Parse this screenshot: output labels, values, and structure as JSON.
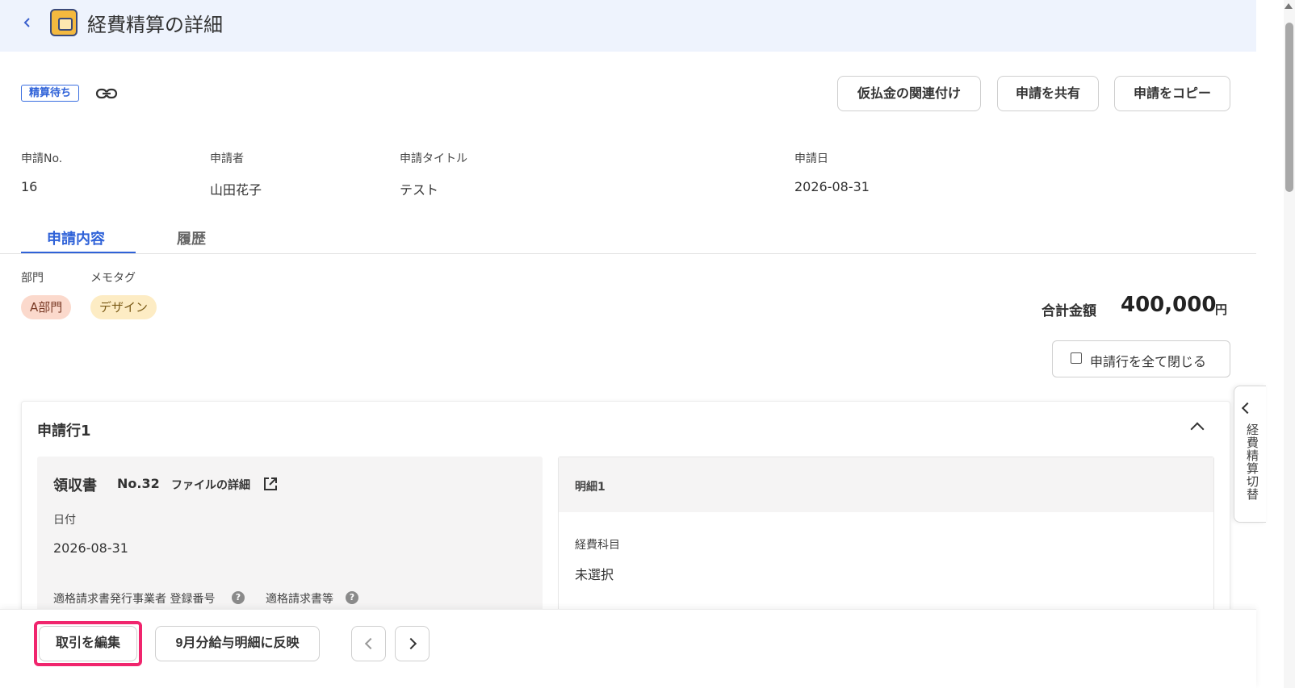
{
  "header": {
    "back_icon": "chevron-left-icon",
    "app_icon": "wallet-icon",
    "title": "経費精算の詳細"
  },
  "status": {
    "badge": "精算待ち",
    "link_icon": "link-icon"
  },
  "actions": {
    "link_advance": "仮払金の関連付け",
    "share": "申請を共有",
    "copy": "申請をコピー"
  },
  "info": {
    "no_label": "申請No.",
    "no_value": "16",
    "applicant_label": "申請者",
    "applicant_value": "山田花子",
    "title_label": "申請タイトル",
    "title_value": "テスト",
    "date_label": "申請日",
    "date_value": "2026-08-31"
  },
  "tabs": [
    {
      "label": "申請内容",
      "active": true
    },
    {
      "label": "履歴",
      "active": false
    }
  ],
  "meta": {
    "dept_label": "部門",
    "dept_tag": "A部門",
    "memo_label": "メモタグ",
    "memo_tag": "デザイン"
  },
  "total": {
    "label": "合計金額",
    "value": "400,000",
    "unit": "円"
  },
  "close_all": {
    "label": "申請行を全て閉じる",
    "checked": false
  },
  "side_toggle": {
    "label": "経費精算切替"
  },
  "line": {
    "title": "申請行1",
    "receipt": {
      "title": "領収書",
      "no": "No.32",
      "file_detail": "ファイルの詳細",
      "date_label": "日付",
      "date_value": "2026-08-31",
      "reg_label": "適格請求書発行事業者 登録番号",
      "invoice_label": "適格請求書等"
    },
    "detail": {
      "title": "明細1",
      "account_label": "経費科目",
      "account_value": "未選択"
    }
  },
  "bottom": {
    "edit": "取引を編集",
    "reflect": "9月分給与明細に反映"
  },
  "colors": {
    "accent": "#2f62d8",
    "highlight": "#f0256d",
    "header_bg": "#eef3fd"
  }
}
